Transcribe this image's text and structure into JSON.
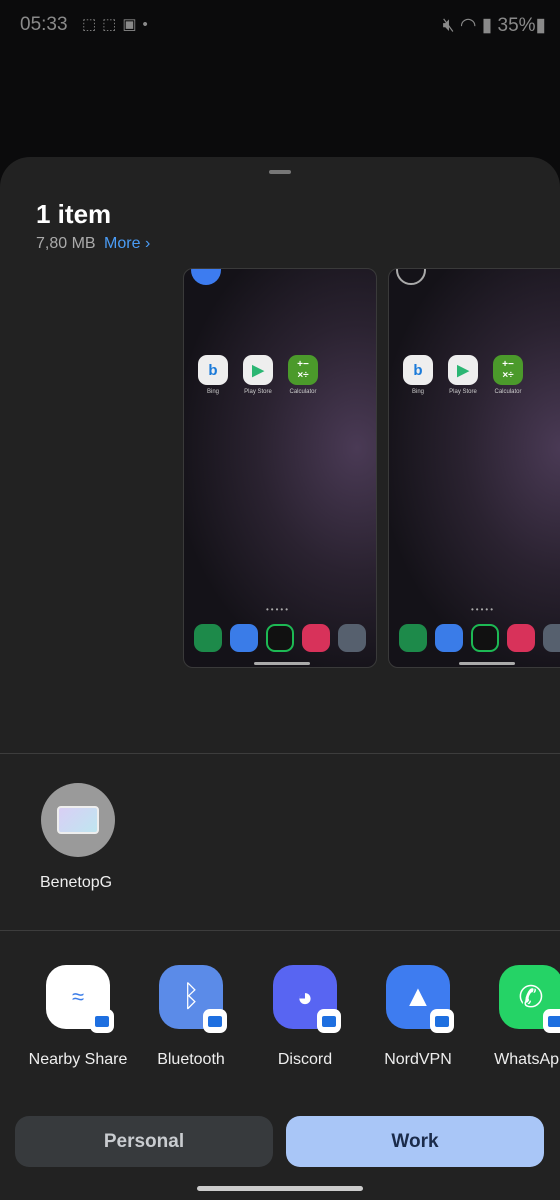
{
  "status_bar": {
    "time": "05:33",
    "battery": "35%",
    "left_icons": [
      "screen-record-icon",
      "screen-record-icon",
      "image-icon",
      "dot-icon"
    ],
    "right_icons": [
      "mute-icon",
      "wifi-icon",
      "wifi-call-icon",
      "signal-icon",
      "battery-icon"
    ]
  },
  "sheet": {
    "title": "1 item",
    "size": "7,80 MB",
    "more_label": "More",
    "more_icon": "chevron-right-icon"
  },
  "thumbnails": [
    {
      "selected": true,
      "apps": [
        "Bing",
        "Play Store",
        "Calculator"
      ]
    },
    {
      "selected": false,
      "apps": [
        "Bing",
        "Play Store",
        "Calculator"
      ]
    }
  ],
  "nearby_device": {
    "label": "BenetopG"
  },
  "share_apps": [
    {
      "label": "Nearby Share",
      "color": "#ffffff"
    },
    {
      "label": "Bluetooth",
      "color": "#5b8be8"
    },
    {
      "label": "Discord",
      "color": "#5865f2"
    },
    {
      "label": "NordVPN",
      "color": "#3e7cf0"
    },
    {
      "label": "WhatsApp",
      "color": "#25d366"
    }
  ],
  "profile_tabs": {
    "personal": "Personal",
    "work": "Work",
    "active": "Work"
  },
  "colors": {
    "accent": "#4a9cf5",
    "work_active": "#a9c6f7"
  }
}
